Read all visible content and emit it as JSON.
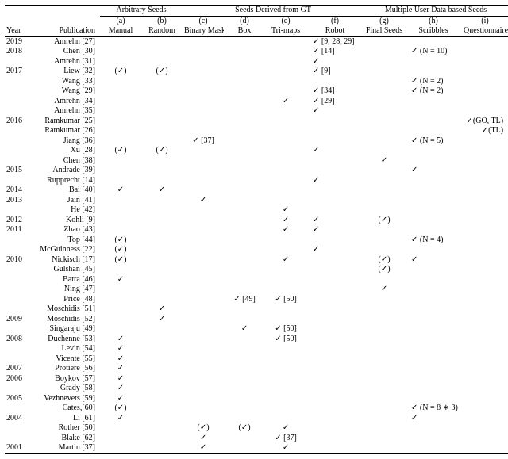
{
  "groupHeaders": [
    "Arbitrary Seeds",
    "Seeds Derived from GT",
    "Multiple User Data based Seeds"
  ],
  "colLetters": [
    "(a)",
    "(b)",
    "(c)",
    "(d)",
    "(e)",
    "(f)",
    "(g)",
    "(h)",
    "(i)"
  ],
  "colNames": [
    "Year",
    "Publication",
    "Manual",
    "Random",
    "Binary Mask",
    "Box",
    "Tri-maps",
    "Robot",
    "Final Seeds",
    "Scribbles",
    "Questionnaire"
  ],
  "rows": [
    {
      "year": "2019",
      "pub": "Amrehn [27]",
      "f": "✓ [9, 28, 29]"
    },
    {
      "year": "2018",
      "pub": "Chen [30]",
      "f": "✓ [14]",
      "h": "✓ (N = 10)"
    },
    {
      "year": "",
      "pub": "Amrehn [31]",
      "f": "✓"
    },
    {
      "year": "2017",
      "pub": "Liew [32]",
      "a": "(✓)",
      "b": "(✓)",
      "f": "✓ [9]"
    },
    {
      "year": "",
      "pub": "Wang [33]",
      "h": "✓ (N = 2)"
    },
    {
      "year": "",
      "pub": "Wang [29]",
      "f": "✓ [34]",
      "h": "✓ (N = 2)"
    },
    {
      "year": "",
      "pub": "Amrehn [34]",
      "e": "✓",
      "f": "✓ [29]"
    },
    {
      "year": "",
      "pub": "Amrehn [35]",
      "f": "✓"
    },
    {
      "year": "2016",
      "pub": "Ramkumar [25]",
      "i": "✓(GO, TL)"
    },
    {
      "year": "",
      "pub": "Ramkumar [26]",
      "i": "✓(TL)"
    },
    {
      "year": "",
      "pub": "Jiang [36]",
      "c": "✓ [37]",
      "h": "✓ (N = 5)"
    },
    {
      "year": "",
      "pub": "Xu [28]",
      "a": "(✓)",
      "b": "(✓)",
      "f": "✓"
    },
    {
      "year": "",
      "pub": "Chen [38]",
      "g": "✓"
    },
    {
      "year": "2015",
      "pub": "Andrade [39]",
      "h": "✓"
    },
    {
      "year": "",
      "pub": "Rupprecht [14]",
      "f": "✓"
    },
    {
      "year": "2014",
      "pub": "Bai [40]",
      "a": "✓",
      "b": "✓"
    },
    {
      "year": "2013",
      "pub": "Jain [41]",
      "c": "✓"
    },
    {
      "year": "",
      "pub": "He [42]",
      "e": "✓"
    },
    {
      "year": "2012",
      "pub": "Kohli [9]",
      "e": "✓",
      "f": "✓",
      "g": "(✓)"
    },
    {
      "year": "2011",
      "pub": "Zhao [43]",
      "e": "✓",
      "f": "✓"
    },
    {
      "year": "",
      "pub": "Top [44]",
      "a": "(✓)",
      "h": "✓ (N = 4)"
    },
    {
      "year": "",
      "pub": "McGuinness [22]",
      "a": "(✓)",
      "f": "✓"
    },
    {
      "year": "2010",
      "pub": "Nickisch [17]",
      "a": "(✓)",
      "e": "✓",
      "g": "(✓)",
      "h": "✓"
    },
    {
      "year": "",
      "pub": "Gulshan [45]",
      "g": "(✓)"
    },
    {
      "year": "",
      "pub": "Batra [46]",
      "a": "✓"
    },
    {
      "year": "",
      "pub": "Ning [47]",
      "g": "✓"
    },
    {
      "year": "",
      "pub": "Price [48]",
      "d": "✓ [49]",
      "e": "✓ [50]"
    },
    {
      "year": "",
      "pub": "Moschidis [51]",
      "b": "✓"
    },
    {
      "year": "2009",
      "pub": "Moschidis [52]",
      "b": "✓"
    },
    {
      "year": "",
      "pub": "Singaraju [49]",
      "d": "✓",
      "e": "✓ [50]"
    },
    {
      "year": "2008",
      "pub": "Duchenne [53]",
      "a": "✓",
      "e": "✓ [50]"
    },
    {
      "year": "",
      "pub": "Levin [54]",
      "a": "✓"
    },
    {
      "year": "",
      "pub": "Vicente [55]",
      "a": "✓"
    },
    {
      "year": "2007",
      "pub": "Protiere [56]",
      "a": "✓"
    },
    {
      "year": "2006",
      "pub": "Boykov [57]",
      "a": "✓"
    },
    {
      "year": "",
      "pub": "Grady [58]",
      "a": "✓"
    },
    {
      "year": "2005",
      "pub": "Vezhnevets [59]",
      "a": "✓"
    },
    {
      "year": "",
      "pub": "Cates,[60]",
      "a": "(✓)",
      "h": "✓ (N = 8 ∗ 3)"
    },
    {
      "year": "2004",
      "pub": "Li [61]",
      "a": "✓",
      "h": "✓"
    },
    {
      "year": "",
      "pub": "Rother [50]",
      "c": "(✓)",
      "d": "(✓)",
      "e": "✓"
    },
    {
      "year": "",
      "pub": "Blake [62]",
      "c": "✓",
      "e": "✓ [37]"
    },
    {
      "year": "2001",
      "pub": "Martin [37]",
      "c": "✓",
      "e": "✓"
    }
  ]
}
